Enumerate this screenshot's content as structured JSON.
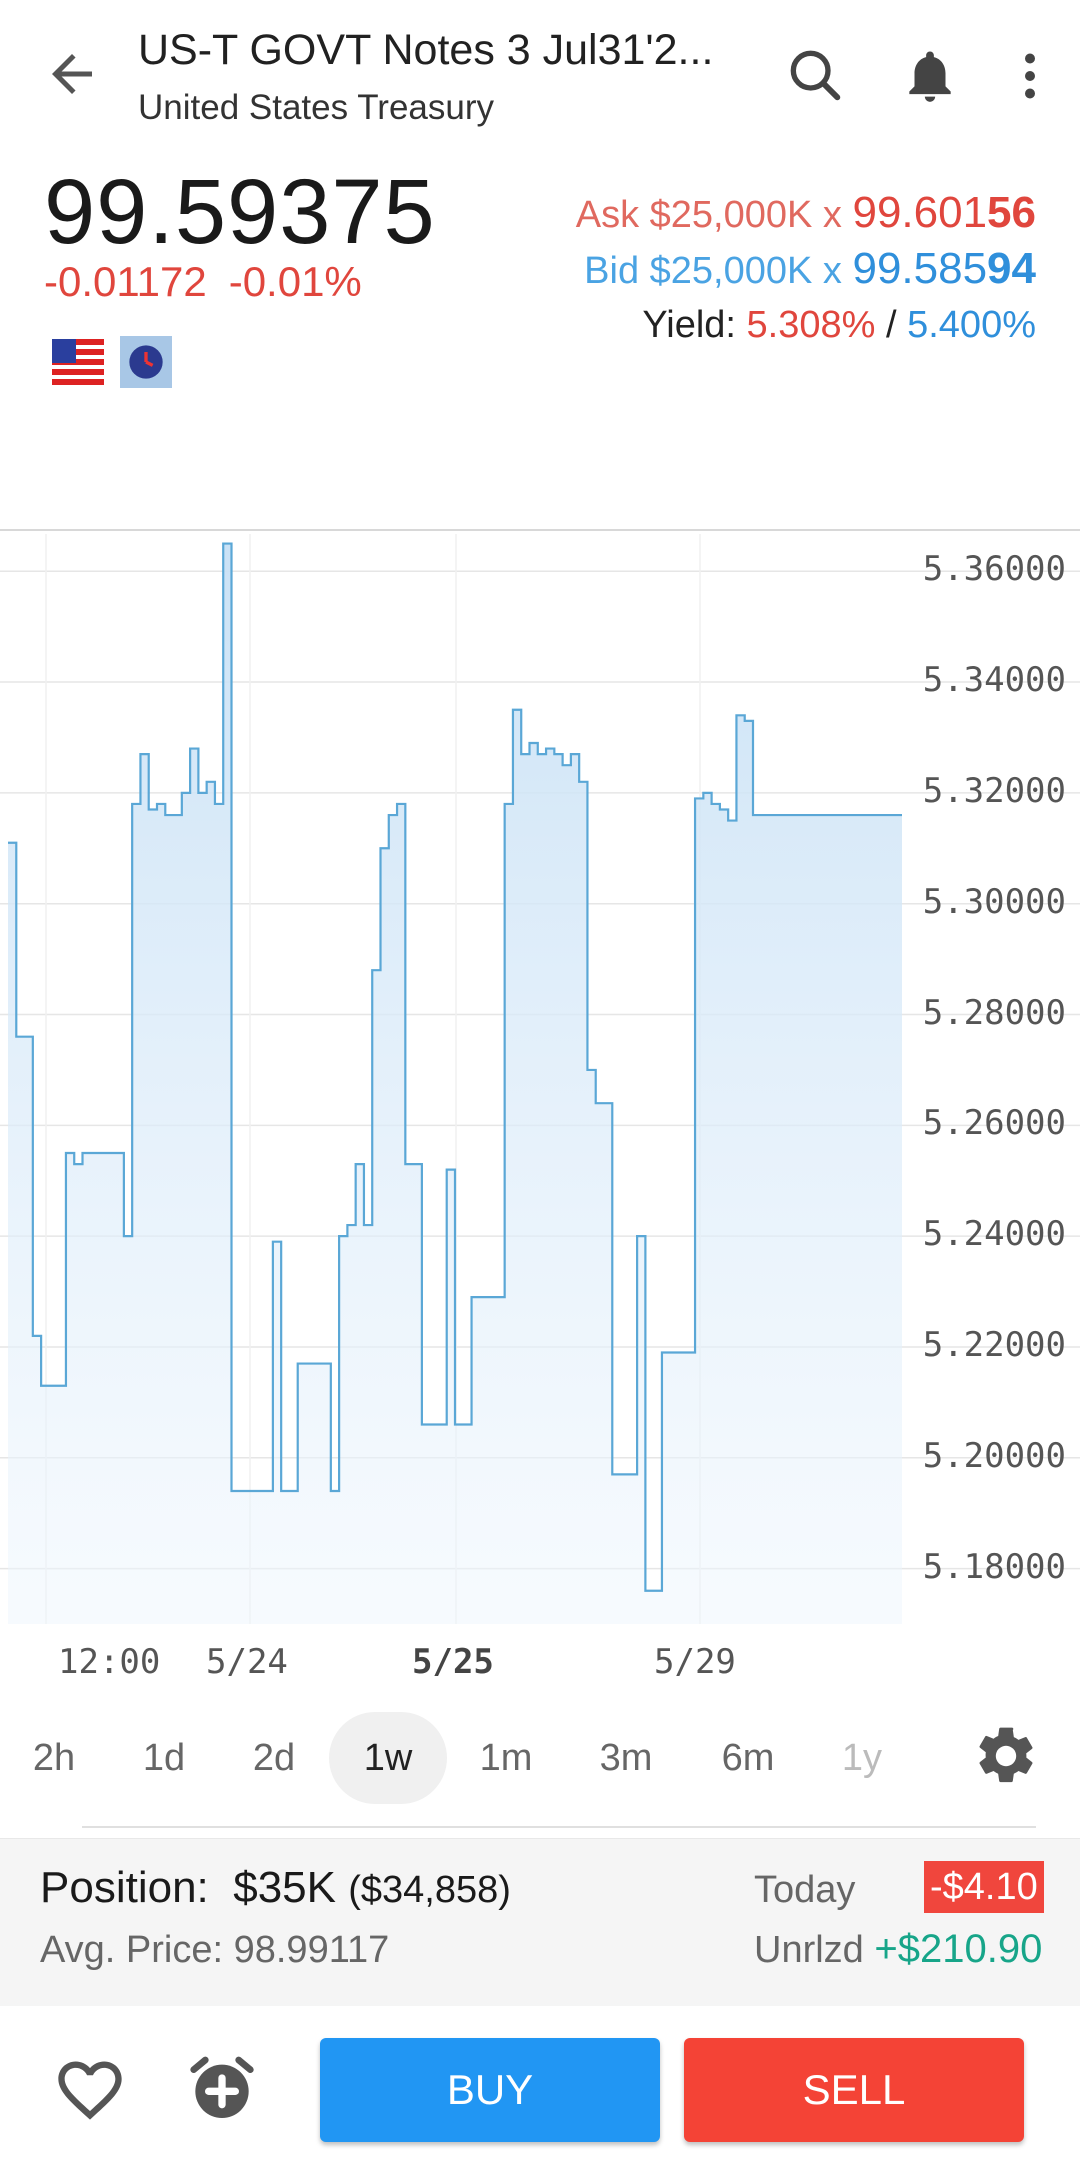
{
  "header": {
    "title": "US-T GOVT Notes 3 Jul31'2...",
    "subtitle": "United States Treasury",
    "icons": [
      "back-arrow-icon",
      "search-icon",
      "bell-icon",
      "more-vert-icon"
    ]
  },
  "quote": {
    "price": "99.59375",
    "change": "-0.01172",
    "change_pct": "-0.01%",
    "ask_label": "Ask",
    "ask_size": "$25,000K x",
    "ask_price_main": "99.601",
    "ask_price_bold": "56",
    "bid_label": "Bid",
    "bid_size": "$25,000K x",
    "bid_price_main": "99.585",
    "bid_price_bold": "94",
    "yield_label": "Yield:",
    "yield_ask": "5.308%",
    "yield_sep": "/",
    "yield_bid": "5.400%"
  },
  "colors": {
    "negative": "#e0463d",
    "ask": "#e0695f",
    "bid": "#2f8fdb",
    "positive": "#17a589",
    "line": "#5aa7d6",
    "buy": "#2196f3",
    "sell": "#f44336"
  },
  "chart_data": {
    "type": "area",
    "ylim": [
      5.17,
      5.366
    ],
    "y_ticks": [
      "5.36000",
      "5.34000",
      "5.32000",
      "5.30000",
      "5.28000",
      "5.26000",
      "5.24000",
      "5.22000",
      "5.20000",
      "5.18000"
    ],
    "x_ticks": [
      {
        "label": "12:00",
        "bold": false
      },
      {
        "label": "5/24",
        "bold": false
      },
      {
        "label": "5/25",
        "bold": true
      },
      {
        "label": "5/29",
        "bold": false
      }
    ],
    "x": [
      0,
      1,
      2,
      3,
      4,
      5,
      6,
      7,
      8,
      9,
      10,
      11,
      12,
      13,
      14,
      15,
      16,
      17,
      18,
      19,
      20,
      21,
      22,
      23,
      24,
      25,
      26,
      27,
      28,
      29,
      30,
      31,
      32,
      33,
      34,
      35,
      36,
      37,
      38,
      39,
      40,
      41,
      42,
      43,
      44,
      45,
      46,
      47,
      48,
      49,
      50,
      51,
      52,
      53,
      54,
      55,
      56,
      57,
      58,
      59,
      60,
      61,
      62,
      63,
      64,
      65,
      66,
      67,
      68,
      69,
      70,
      71,
      72,
      73,
      74,
      75,
      76,
      77,
      78,
      79,
      80,
      81,
      82,
      83,
      84,
      85,
      86,
      87,
      88,
      89,
      90,
      91,
      92,
      93,
      94,
      95,
      96,
      97,
      98,
      99,
      100,
      101,
      102,
      103,
      104,
      105,
      106,
      107,
      108
    ],
    "values": [
      5.311,
      5.276,
      5.276,
      5.222,
      5.213,
      5.213,
      5.213,
      5.255,
      5.253,
      5.255,
      5.255,
      5.255,
      5.255,
      5.255,
      5.24,
      5.318,
      5.327,
      5.317,
      5.318,
      5.316,
      5.316,
      5.32,
      5.328,
      5.32,
      5.322,
      5.318,
      5.365,
      5.194,
      5.194,
      5.194,
      5.194,
      5.194,
      5.239,
      5.194,
      5.194,
      5.217,
      5.217,
      5.217,
      5.217,
      5.194,
      5.24,
      5.242,
      5.253,
      5.242,
      5.288,
      5.31,
      5.316,
      5.318,
      5.253,
      5.253,
      5.206,
      5.206,
      5.206,
      5.252,
      5.206,
      5.206,
      5.229,
      5.229,
      5.229,
      5.229,
      5.318,
      5.335,
      5.327,
      5.329,
      5.327,
      5.328,
      5.327,
      5.325,
      5.327,
      5.322,
      5.27,
      5.264,
      5.264,
      5.197,
      5.197,
      5.197,
      5.24,
      5.176,
      5.176,
      5.219,
      5.219,
      5.219,
      5.219,
      5.319,
      5.32,
      5.318,
      5.317,
      5.315,
      5.334,
      5.333,
      5.316,
      5.316,
      5.316,
      5.316,
      5.316,
      5.316,
      5.316,
      5.316,
      5.316,
      5.316,
      5.316,
      5.316,
      5.316,
      5.316,
      5.316,
      5.316,
      5.316,
      5.316,
      5.316
    ]
  },
  "ranges": [
    {
      "label": "2h",
      "active": false,
      "disabled": false
    },
    {
      "label": "1d",
      "active": false,
      "disabled": false
    },
    {
      "label": "2d",
      "active": false,
      "disabled": false
    },
    {
      "label": "1w",
      "active": true,
      "disabled": false
    },
    {
      "label": "1m",
      "active": false,
      "disabled": false
    },
    {
      "label": "3m",
      "active": false,
      "disabled": false
    },
    {
      "label": "6m",
      "active": false,
      "disabled": false
    },
    {
      "label": "1y",
      "active": false,
      "disabled": true
    }
  ],
  "position": {
    "label": "Position:",
    "value": "$35K",
    "exact": "($34,858)",
    "avg_label": "Avg. Price:",
    "avg_value": "98.99117",
    "today_label": "Today",
    "today_value": "-$4.10",
    "unrlzd_label": "Unrlzd",
    "unrlzd_value": "+$210.90"
  },
  "actions": {
    "buy_label": "BUY",
    "sell_label": "SELL"
  }
}
